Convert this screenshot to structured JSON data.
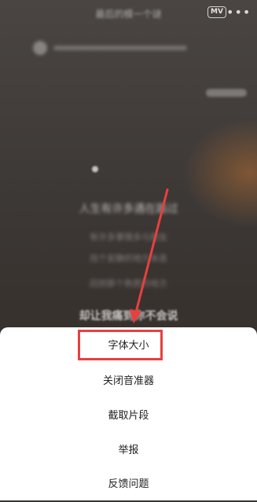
{
  "background": {
    "song_title": "最后的模一个谜",
    "lyric_main": "人生有许多遇在路过",
    "lyric_line_2": "有许多事情多与朋友",
    "lyric_line_3": "找个安静的地方休息",
    "lyric_line_4": "回到那个熟悉的地方",
    "lyric_bold": "却让我痛到你不会说",
    "mv_badge": "MV",
    "more_icon": "more-dots-icon"
  },
  "menu": {
    "items": [
      {
        "label": "字体大小"
      },
      {
        "label": "关闭音准器"
      },
      {
        "label": "截取片段"
      },
      {
        "label": "举报"
      },
      {
        "label": "反馈问题"
      }
    ]
  },
  "annotation": {
    "color": "#e8403e",
    "highlighted_item": "字体大小"
  }
}
